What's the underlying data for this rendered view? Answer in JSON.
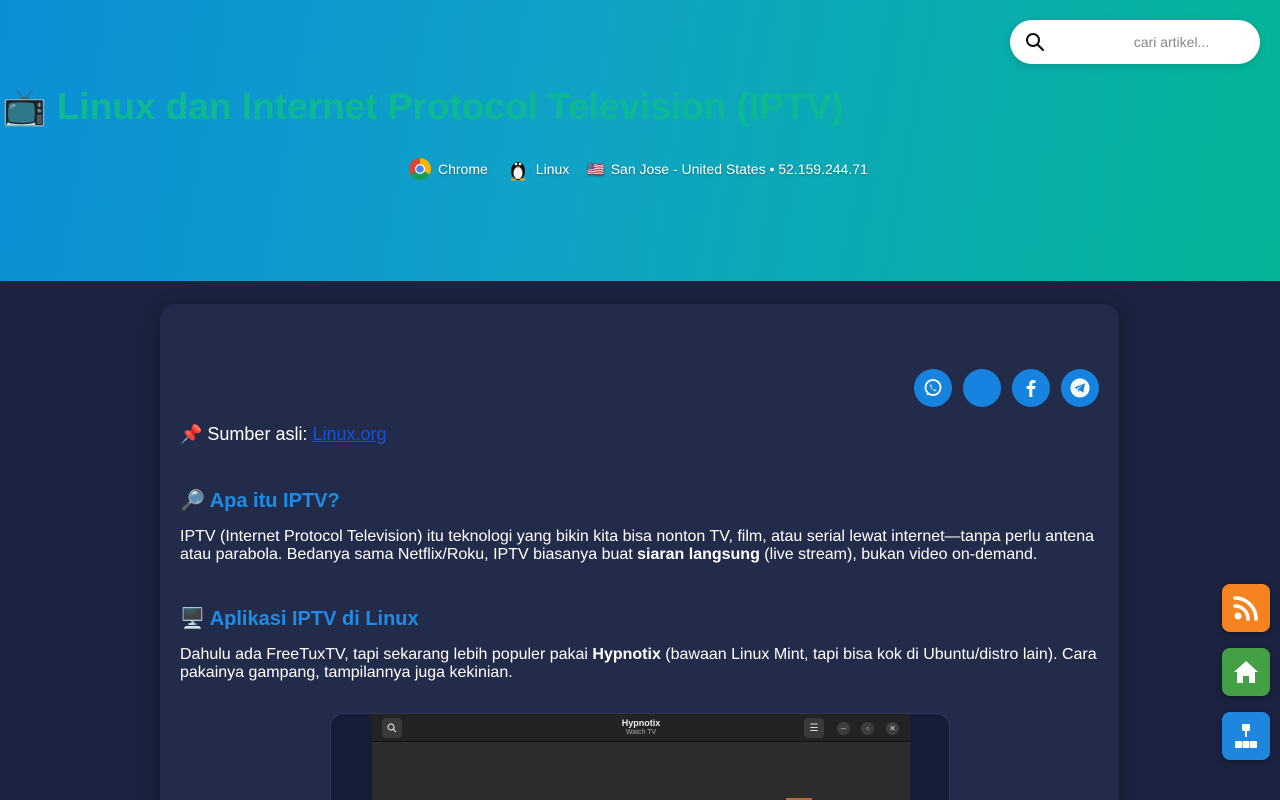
{
  "search": {
    "placeholder": "cari artikel..."
  },
  "header": {
    "tv_emoji": "📺",
    "title": "Linux dan Internet Protocol Television (IPTV)",
    "meta": {
      "browser": "Chrome",
      "os": "Linux",
      "flag_emoji": "🇺🇸",
      "location": "San Jose - United States • 52.159.244.71"
    }
  },
  "share": {
    "buttons": [
      "whatsapp-icon",
      "blank-share",
      "facebook-icon",
      "telegram-icon"
    ]
  },
  "article": {
    "source_prefix": "📌 Sumber asli: ",
    "source_link": "Linux.org",
    "sections": [
      {
        "heading": "🔎 Apa itu IPTV?",
        "text_a": "IPTV (Internet Protocol Television) itu teknologi yang bikin kita bisa nonton TV, film, atau serial lewat internet—tanpa perlu antena atau parabola. Bedanya sama Netflix/Roku, IPTV biasanya buat ",
        "bold": "siaran langsung",
        "text_b": " (live stream), bukan video on-demand."
      },
      {
        "heading": "🖥️ Aplikasi IPTV di Linux",
        "text_a": "Dahulu ada FreeTuxTV, tapi sekarang lebih populer pakai ",
        "bold": "Hypnotix",
        "text_b": " (bawaan Linux Mint, tapi bisa kok di Ubuntu/distro lain). Cara pakainya gampang, tampilannya juga kekinian."
      }
    ]
  },
  "preview": {
    "app_title": "Hypnotix",
    "app_subtitle": "Watch TV",
    "menu_glyph": "☰",
    "min_glyph": "–",
    "max_glyph": "▫",
    "close_glyph": "✕"
  },
  "colors": {
    "title_green": "#0cb993",
    "link_blue": "#1a50d8",
    "heading_blue": "#1e8ce6",
    "rss_orange": "#f5831f",
    "home_green": "#43a047",
    "sitemap_blue": "#1f86de"
  },
  "side_buttons": [
    "rss-icon",
    "home-icon",
    "sitemap-icon"
  ]
}
